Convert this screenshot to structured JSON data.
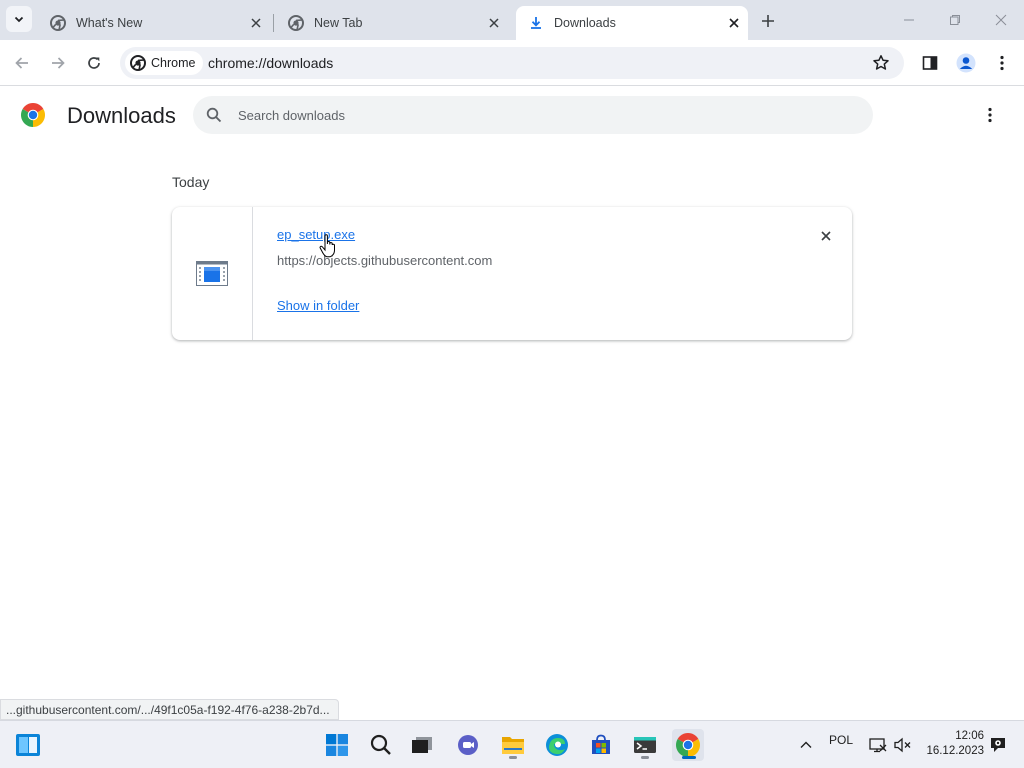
{
  "tabs": [
    {
      "title": "What's New",
      "icon": "chrome-icon",
      "active": false
    },
    {
      "title": "New Tab",
      "icon": "chrome-icon",
      "active": false
    },
    {
      "title": "Downloads",
      "icon": "download-icon",
      "active": true
    }
  ],
  "omnibox": {
    "chip_label": "Chrome",
    "url": "chrome://downloads"
  },
  "page": {
    "title": "Downloads",
    "search_placeholder": "Search downloads"
  },
  "downloads": {
    "date_heading": "Today",
    "items": [
      {
        "file_name": "ep_setup.exe",
        "source_url": "https://objects.githubusercontent.com",
        "action_label": "Show in folder"
      }
    ]
  },
  "status_bar": {
    "text": "...githubusercontent.com/.../49f1c05a-f192-4f76-a238-2b7d..."
  },
  "taskbar": {
    "apps": [
      "start-icon",
      "search-icon",
      "task-view-icon",
      "teams-chat-icon",
      "file-explorer-icon",
      "edge-icon",
      "store-icon",
      "terminal-icon",
      "chrome-icon"
    ],
    "language": "POL",
    "time": "12:06",
    "date": "16.12.2023"
  },
  "colors": {
    "accent": "#1a73e8",
    "tabstrip_bg": "#dfe3eb",
    "omnibox_bg": "#eff1f6"
  }
}
